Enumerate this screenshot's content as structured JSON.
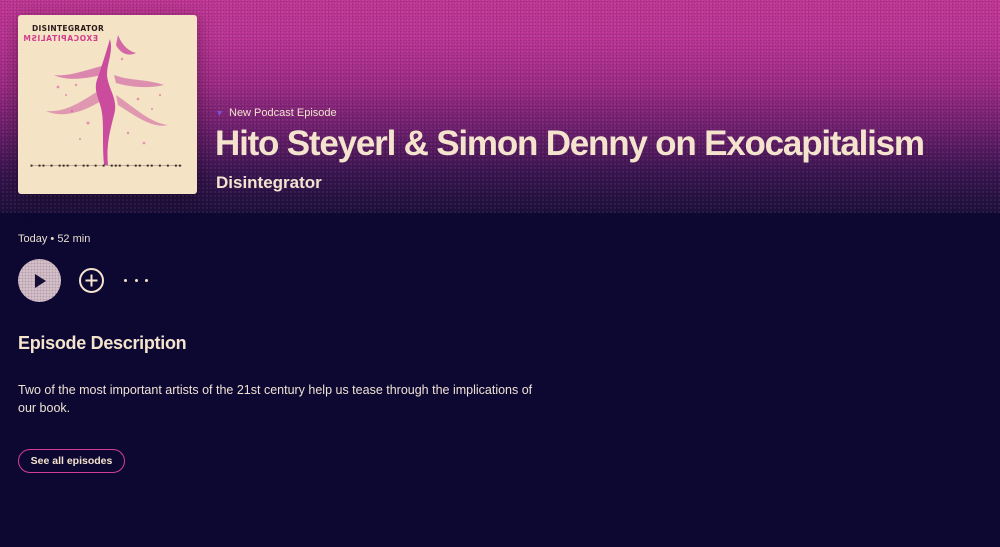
{
  "episode": {
    "eyebrow": "New Podcast Episode",
    "title": "Hito Steyerl & Simon Denny on Exocapitalism",
    "show": "Disintegrator",
    "meta": "Today • 52 min"
  },
  "cover": {
    "title": "DISINTEGRATOR",
    "subtitle": "EXOCAPITALISM"
  },
  "controls": {
    "play_icon": "play-icon",
    "add_icon": "plus-circle-icon",
    "more_icon": "more-horizontal-icon"
  },
  "description": {
    "heading": "Episode Description",
    "text": "Two of the most important artists of the 21st century help us tease through the implications of our book."
  },
  "actions": {
    "see_all_label": "See all episodes"
  },
  "colors": {
    "background": "#0d0832",
    "hero_pink": "#c8389a",
    "text_cream": "#f5e4cd",
    "accent_border": "#d23d9b",
    "podcast_badge": "#7b4fd6"
  }
}
